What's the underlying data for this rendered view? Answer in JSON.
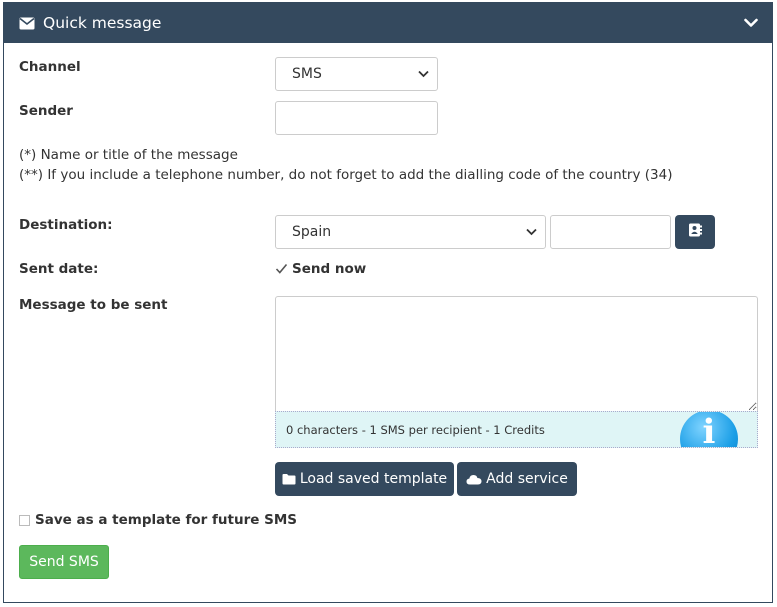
{
  "header": {
    "title": "Quick message",
    "icons": [
      "envelope-icon",
      "chevron-down-icon"
    ]
  },
  "form": {
    "channel_label": "Channel",
    "channel_value": "SMS",
    "sender_label": "Sender",
    "sender_value": "",
    "note1": "(*) Name or title of the message",
    "note2": "(**) If you include a telephone number, do not forget to add the dialling code of the country (34)",
    "destination_label": "Destination:",
    "destination_country": "Spain",
    "destination_number": "",
    "sent_date_label": "Sent date:",
    "send_now_label": "Send now",
    "send_now_checked": true,
    "message_label": "Message to be sent",
    "message_value": "",
    "counter_text": "0 characters - 1 SMS per recipient - 1 Credits",
    "info_icon": "i",
    "load_template_label": "Load saved template",
    "add_service_label": "Add service",
    "save_template_label": "Save as a template for future SMS",
    "save_template_checked": false,
    "send_button_label": "Send SMS"
  },
  "colors": {
    "header_bg": "#34495e",
    "button_bg": "#34495e",
    "send_green": "#5cb85c",
    "counter_bg": "#dff5f6"
  }
}
